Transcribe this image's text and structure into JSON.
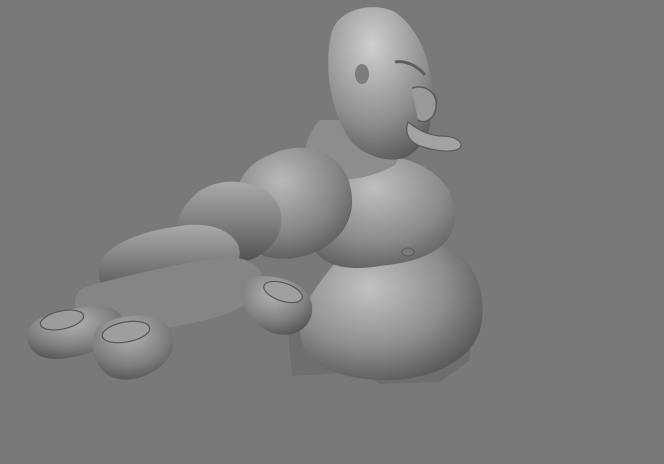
{
  "viewport": {
    "background": "#797979",
    "model_shade": "#8c8c8c",
    "model_highlight": "#c8c8c8",
    "model_shadow": "#4a4a4a"
  }
}
